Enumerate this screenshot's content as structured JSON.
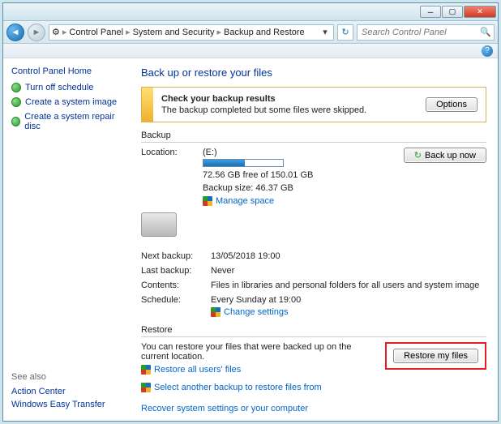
{
  "titlebar": {
    "min": "─",
    "max": "▢",
    "close": "✕"
  },
  "nav": {
    "back": "◄",
    "fwd": "►",
    "icon": "⚙",
    "crumbs": [
      "Control Panel",
      "System and Security",
      "Backup and Restore"
    ],
    "dropdown": "▾",
    "refresh": "↻",
    "search_placeholder": "Search Control Panel",
    "search_icon": "🔍",
    "help_icon": "?"
  },
  "sidebar": {
    "home": "Control Panel Home",
    "links": [
      "Turn off schedule",
      "Create a system image",
      "Create a system repair disc"
    ],
    "seealso_hd": "See also",
    "seealso": [
      "Action Center",
      "Windows Easy Transfer"
    ]
  },
  "main": {
    "heading": "Back up or restore your files",
    "check": {
      "title": "Check your backup results",
      "msg": "The backup completed but some files were skipped.",
      "options_btn": "Options"
    },
    "backup": {
      "hd": "Backup",
      "location_lbl": "Location:",
      "location_val": "(E:)",
      "free_text": "72.56 GB free of 150.01 GB",
      "size_text": "Backup size: 46.37 GB",
      "manage_link": "Manage space",
      "backup_now_btn": "Back up now",
      "backup_now_icon": "↻",
      "rows": [
        {
          "lbl": "Next backup:",
          "val": "13/05/2018 19:00"
        },
        {
          "lbl": "Last backup:",
          "val": "Never"
        },
        {
          "lbl": "Contents:",
          "val": "Files in libraries and personal folders for all users and system image"
        },
        {
          "lbl": "Schedule:",
          "val": "Every Sunday at 19:00"
        }
      ],
      "change_link": "Change settings"
    },
    "restore": {
      "hd": "Restore",
      "text": "You can restore your files that were backed up on the current location.",
      "restore_all": "Restore all users' files",
      "select_another": "Select another backup to restore files from",
      "recover": "Recover system settings or your computer",
      "restore_btn": "Restore my files"
    }
  }
}
